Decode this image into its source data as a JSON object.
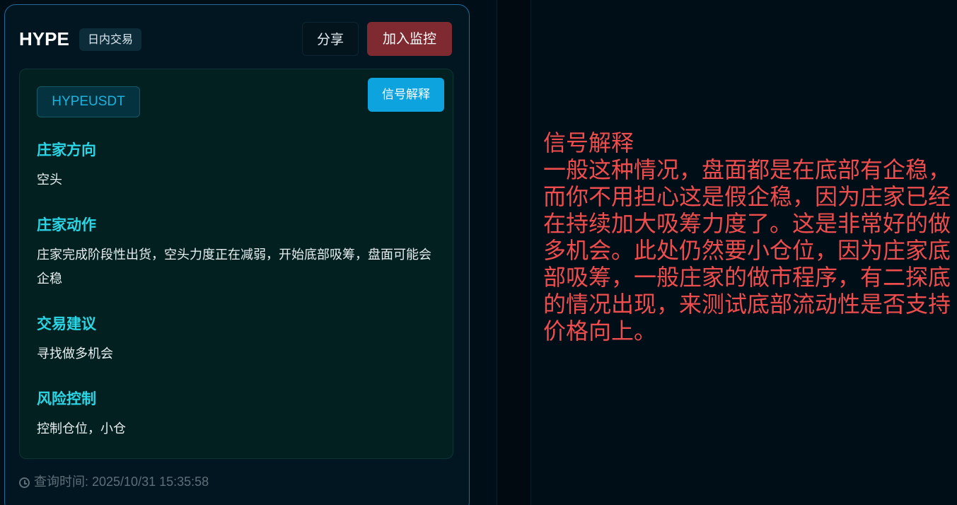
{
  "card": {
    "symbol": "HYPE",
    "trade_type": "日内交易",
    "share_label": "分享",
    "monitor_label": "加入监控",
    "pair": "HYPEUSDT",
    "explain_button_label": "信号解释",
    "sections": [
      {
        "title": "庄家方向",
        "body": "空头"
      },
      {
        "title": "庄家动作",
        "body": "庄家完成阶段性出货，空头力度正在减弱，开始底部吸筹，盘面可能会企稳"
      },
      {
        "title": "交易建议",
        "body": "寻找做多机会"
      },
      {
        "title": "风险控制",
        "body": "控制仓位，小仓"
      }
    ],
    "query_time_label": "查询时间: 2025/10/31 15:35:58"
  },
  "explanation": {
    "title": "信号解释",
    "text": "一般这种情况，盘面都是在底部有企稳，而你不用担心这是假企稳，因为庄家已经在持续加大吸筹力度了。这是非常好的做多机会。此处仍然要小仓位，因为庄家底部吸筹，一般庄家的做市程序，有二探底的情况出现，来测试底部流动性是否支持价格向上。"
  },
  "colors": {
    "accent_cyan": "#29d6e6",
    "monitor_button": "#7f2a31",
    "explain_button": "#0ca3df",
    "explanation_text": "#ef4d4d"
  }
}
